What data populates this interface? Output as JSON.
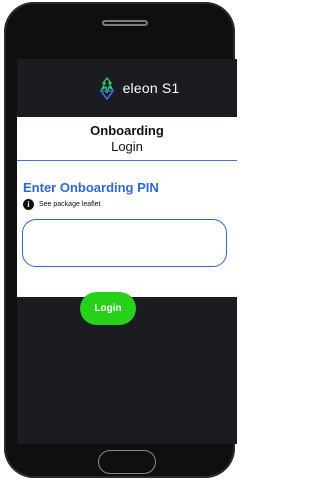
{
  "app": {
    "brand": "eleon S1",
    "logo_icon": "eleon-logo-icon"
  },
  "page": {
    "title": "Onboarding",
    "subtitle": "Login"
  },
  "pin": {
    "label": "Enter Onboarding PIN",
    "hint": "See package leaflet",
    "hint_icon": "info-icon",
    "value": "",
    "placeholder": ""
  },
  "actions": {
    "login_label": "Login"
  },
  "colors": {
    "screen_bg": "#1b1c22",
    "accent_blue": "#2f67d4",
    "login_green": "#27d11a",
    "phone_body": "#0f0f10"
  }
}
